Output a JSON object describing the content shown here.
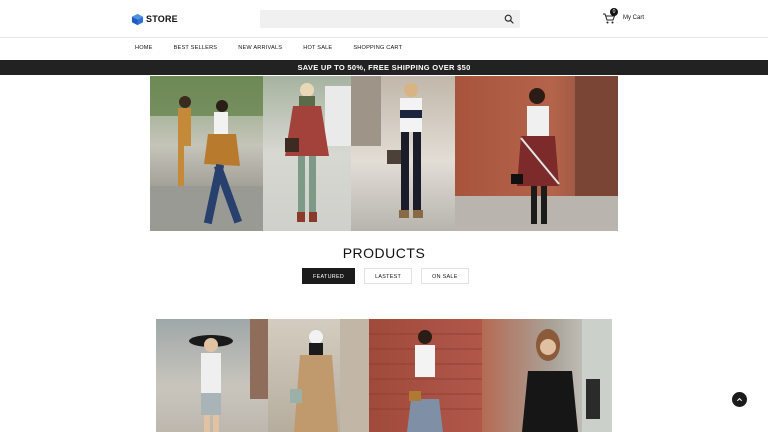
{
  "header": {
    "logo_text": "STORE",
    "search_placeholder": "",
    "cart_count": "0",
    "cart_label": "My Cart"
  },
  "nav": {
    "items": [
      "HOME",
      "BEST SELLERS",
      "NEW ARRIVALS",
      "HOT SALE",
      "SHOPPING CART"
    ]
  },
  "banner": {
    "text": "SAVE UP TO 50%, FREE SHIPPING OVER $50"
  },
  "products": {
    "title": "PRODUCTS",
    "tabs": [
      "FEATURED",
      "LASTEST",
      "ON SALE"
    ],
    "active_tab": "FEATURED"
  },
  "colors": {
    "brand_dark": "#1b1b1b",
    "logo_blue": "#2b6fd6"
  },
  "icons": [
    "logo-cube-icon",
    "search-icon",
    "cart-icon",
    "arrow-up-icon"
  ]
}
